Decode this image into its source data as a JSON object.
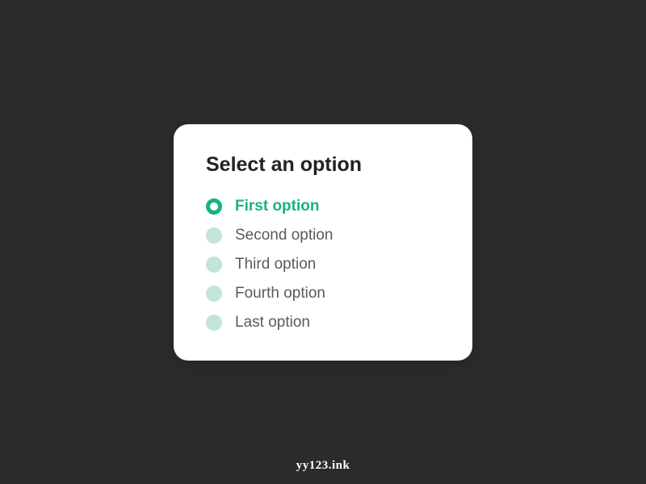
{
  "card": {
    "title": "Select an option",
    "options": [
      {
        "label": "First option",
        "selected": true
      },
      {
        "label": "Second option",
        "selected": false
      },
      {
        "label": "Third option",
        "selected": false
      },
      {
        "label": "Fourth option",
        "selected": false
      },
      {
        "label": "Last option",
        "selected": false
      }
    ]
  },
  "watermark": "yy123.ink"
}
